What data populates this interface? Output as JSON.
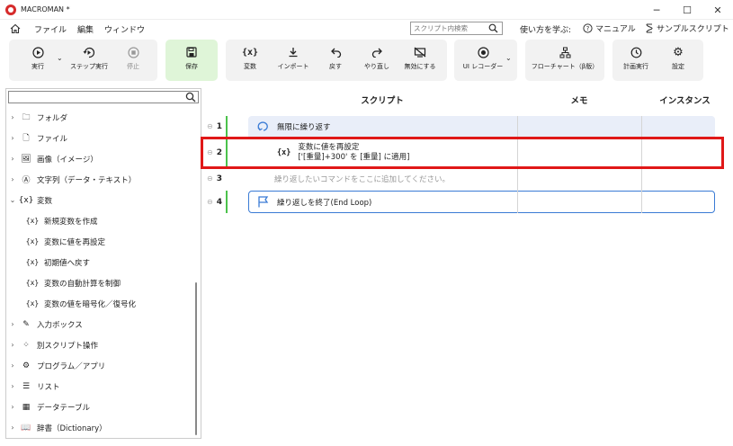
{
  "window": {
    "title": "MACROMAN *",
    "controls": {
      "minimize": "─",
      "maximize": "☐",
      "close": "✕"
    }
  },
  "menu": {
    "items": [
      "ファイル",
      "編集",
      "ウィンドウ"
    ],
    "search_placeholder": "スクリプト内検索",
    "learn_label": "使い方を学ぶ:",
    "manual_label": "マニュアル",
    "sample_label": "サンプルスクリプト"
  },
  "ribbon": {
    "run": "実行",
    "step_run": "ステップ実行",
    "stop": "停止",
    "save": "保存",
    "variable": "変数",
    "import": "インポート",
    "undo": "戻す",
    "redo": "やり直し",
    "disable": "無効にする",
    "ui_recorder": "UI レコーダー",
    "flowchart": "フローチャート（β版）",
    "schedule": "計画実行",
    "settings": "設定"
  },
  "tree": {
    "items": [
      {
        "label": "フォルダ",
        "icon": "folder-icon",
        "glyph": "🗀",
        "expanded": false
      },
      {
        "label": "ファイル",
        "icon": "file-icon",
        "glyph": "🗋",
        "expanded": false
      },
      {
        "label": "画像（イメージ）",
        "icon": "image-icon",
        "glyph": "🖼",
        "expanded": false
      },
      {
        "label": "文字列（データ・テキスト）",
        "icon": "text-icon",
        "glyph": "Ⓐ",
        "expanded": false
      },
      {
        "label": "変数",
        "icon": "variable-icon",
        "glyph": "{x}",
        "expanded": true
      },
      {
        "label": "新規変数を作成",
        "icon": "variable-icon",
        "glyph": "{x}",
        "child": true
      },
      {
        "label": "変数に値を再設定",
        "icon": "variable-icon",
        "glyph": "{x}",
        "child": true
      },
      {
        "label": "初期値へ戻す",
        "icon": "variable-icon",
        "glyph": "{x}",
        "child": true
      },
      {
        "label": "変数の自動計算を制御",
        "icon": "variable-icon",
        "glyph": "{x}",
        "child": true
      },
      {
        "label": "変数の値を暗号化／復号化",
        "icon": "variable-icon",
        "glyph": "{x}",
        "child": true
      },
      {
        "label": "入力ボックス",
        "icon": "input-box-icon",
        "glyph": "✎",
        "expanded": false
      },
      {
        "label": "別スクリプト操作",
        "icon": "script-icon",
        "glyph": "⁘",
        "expanded": false
      },
      {
        "label": "プログラム／アプリ",
        "icon": "program-icon",
        "glyph": "⚙",
        "expanded": false
      },
      {
        "label": "リスト",
        "icon": "list-icon",
        "glyph": "☰",
        "expanded": false
      },
      {
        "label": "データテーブル",
        "icon": "table-icon",
        "glyph": "▦",
        "expanded": false
      },
      {
        "label": "辞書（Dictionary）",
        "icon": "dictionary-icon",
        "glyph": "📖",
        "expanded": false
      }
    ]
  },
  "grid": {
    "headers": {
      "script": "スクリプト",
      "memo": "メモ",
      "instance": "インスタンス"
    },
    "rows": [
      {
        "num": "1",
        "text": "無限に繰り返す"
      },
      {
        "num": "2",
        "line1": "変数に値を再設定",
        "line2": "['[重量]+300' を [重量] に適用]"
      },
      {
        "num": "3",
        "text": "繰り返したいコマンドをここに追加してください。"
      },
      {
        "num": "4",
        "text": "繰り返しを終了(End Loop)"
      }
    ]
  },
  "colors": {
    "accent_green": "#4cc24c",
    "highlight_red": "#e01818",
    "loop_border": "#3a7bd5",
    "loop_bg": "#e9eef9",
    "save_bg": "#dff5d8"
  }
}
